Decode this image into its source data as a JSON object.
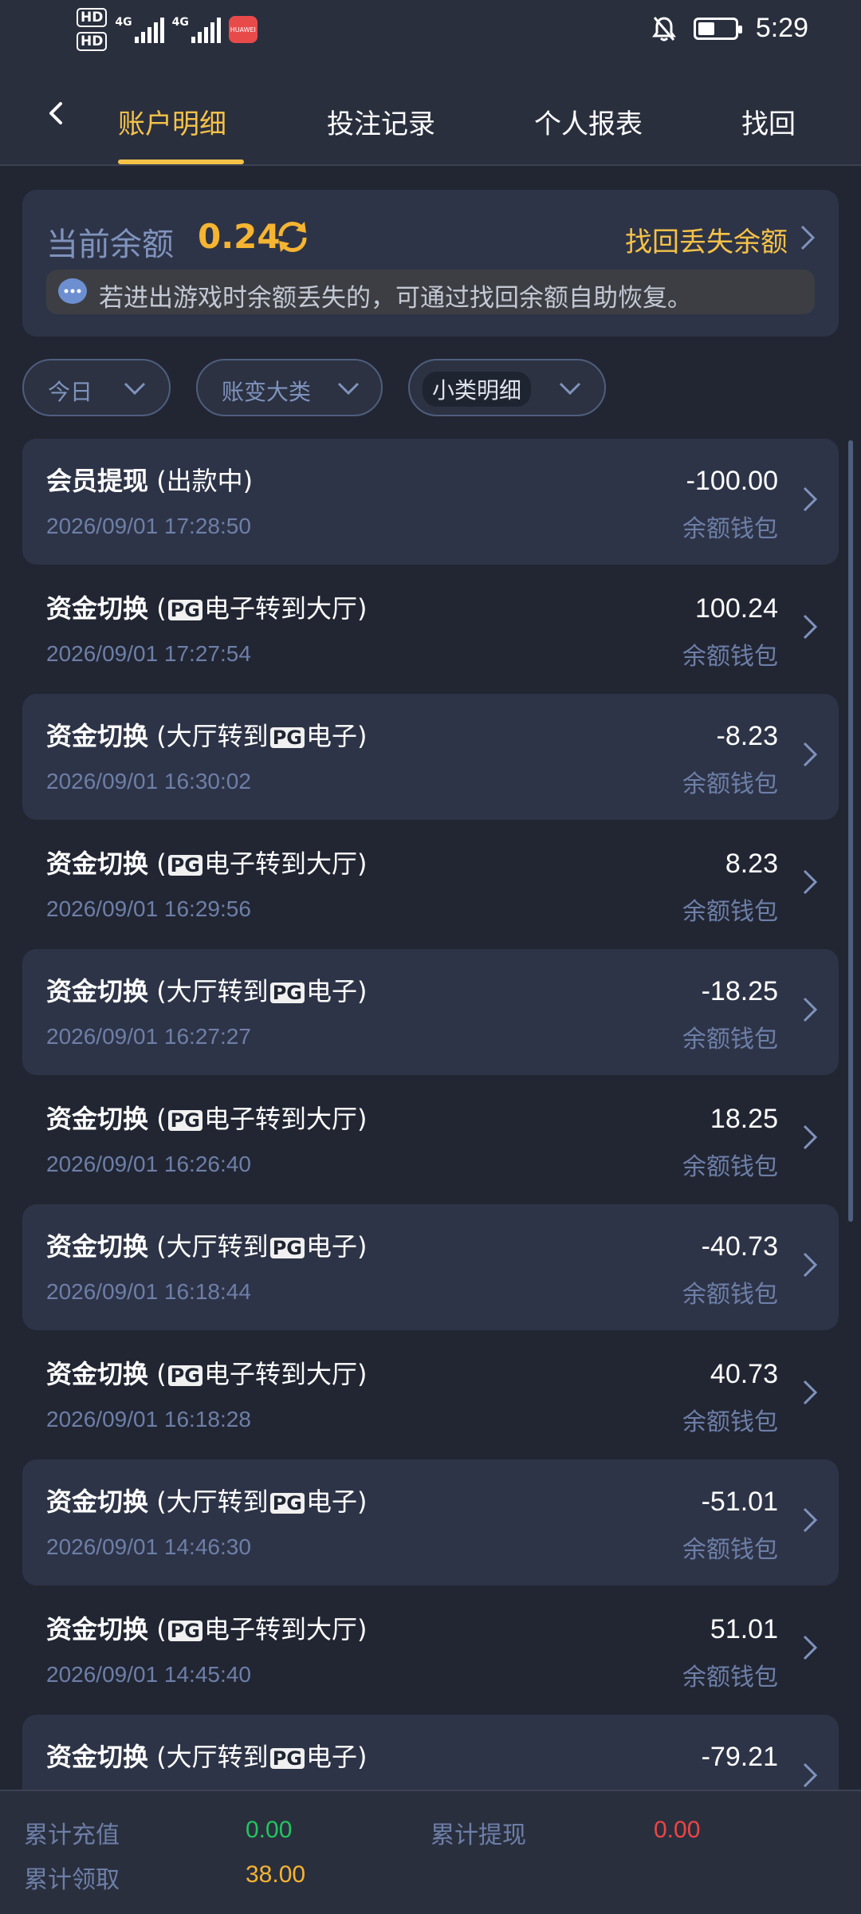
{
  "status_bar": {
    "hd1": "HD",
    "hd2": "HD",
    "sim1_label": "4G",
    "sim2_label": "4G",
    "app_badge": "HUAWEI",
    "time": "5:29"
  },
  "nav": {
    "tabs": [
      {
        "label": "账户明细",
        "active": true
      },
      {
        "label": "投注记录",
        "active": false
      },
      {
        "label": "个人报表",
        "active": false
      },
      {
        "label": "找回",
        "active": false
      }
    ]
  },
  "balance": {
    "label": "当前余额",
    "value": "0.24",
    "recover_label": "找回丢失余额",
    "notice": "若进出游戏时余额丢失的，可通过找回余额自助恢复。"
  },
  "filters": [
    {
      "label": "今日"
    },
    {
      "label": "账变大类"
    },
    {
      "label": "小类明细"
    }
  ],
  "transactions": [
    {
      "title_bold": "会员提现",
      "title_rest": " (出款中)",
      "date": "2026/09/01 17:28:50",
      "amount": "-100.00",
      "wallet": "余额钱包"
    },
    {
      "title_bold": "资金切换",
      "title_pre": " (",
      "pg": "PG",
      "title_post": "电子转到大厅)",
      "date": "2026/09/01 17:27:54",
      "amount": "100.24",
      "wallet": "余额钱包"
    },
    {
      "title_bold": "资金切换",
      "title_pre": " (大厅转到",
      "pg": "PG",
      "title_post": "电子)",
      "date": "2026/09/01 16:30:02",
      "amount": "-8.23",
      "wallet": "余额钱包"
    },
    {
      "title_bold": "资金切换",
      "title_pre": " (",
      "pg": "PG",
      "title_post": "电子转到大厅)",
      "date": "2026/09/01 16:29:56",
      "amount": "8.23",
      "wallet": "余额钱包"
    },
    {
      "title_bold": "资金切换",
      "title_pre": " (大厅转到",
      "pg": "PG",
      "title_post": "电子)",
      "date": "2026/09/01 16:27:27",
      "amount": "-18.25",
      "wallet": "余额钱包"
    },
    {
      "title_bold": "资金切换",
      "title_pre": " (",
      "pg": "PG",
      "title_post": "电子转到大厅)",
      "date": "2026/09/01 16:26:40",
      "amount": "18.25",
      "wallet": "余额钱包"
    },
    {
      "title_bold": "资金切换",
      "title_pre": " (大厅转到",
      "pg": "PG",
      "title_post": "电子)",
      "date": "2026/09/01 16:18:44",
      "amount": "-40.73",
      "wallet": "余额钱包"
    },
    {
      "title_bold": "资金切换",
      "title_pre": " (",
      "pg": "PG",
      "title_post": "电子转到大厅)",
      "date": "2026/09/01 16:18:28",
      "amount": "40.73",
      "wallet": "余额钱包"
    },
    {
      "title_bold": "资金切换",
      "title_pre": " (大厅转到",
      "pg": "PG",
      "title_post": "电子)",
      "date": "2026/09/01 14:46:30",
      "amount": "-51.01",
      "wallet": "余额钱包"
    },
    {
      "title_bold": "资金切换",
      "title_pre": " (",
      "pg": "PG",
      "title_post": "电子转到大厅)",
      "date": "2026/09/01 14:45:40",
      "amount": "51.01",
      "wallet": "余额钱包"
    },
    {
      "title_bold": "资金切换",
      "title_pre": " (大厅转到",
      "pg": "PG",
      "title_post": "电子)",
      "date": "",
      "amount": "-79.21",
      "wallet": ""
    }
  ],
  "summary": {
    "recharge_label": "累计充值",
    "recharge_value": "0.00",
    "withdraw_label": "累计提现",
    "withdraw_value": "0.00",
    "claim_label": "累计领取",
    "claim_value": "38.00"
  },
  "colors": {
    "accent": "#f5c248",
    "balance": "#f5b431",
    "recharge": "#22c55e",
    "withdraw": "#ef4444",
    "claim": "#f5b431"
  }
}
